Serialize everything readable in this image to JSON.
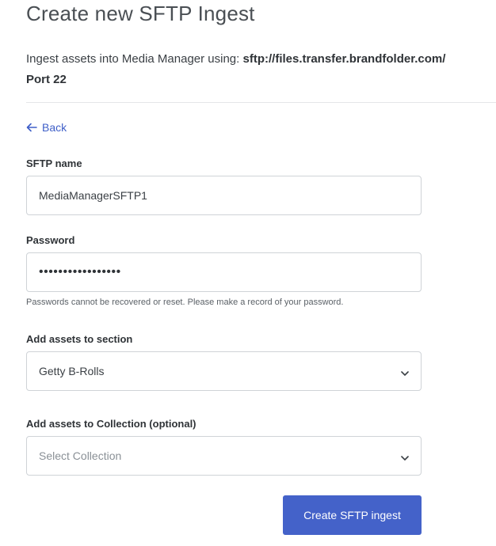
{
  "header": {
    "title": "Create new SFTP Ingest",
    "subtitle_prefix": "Ingest assets into Media Manager using: ",
    "sftp_url": "sftp://files.transfer.brandfolder.com/",
    "port": "Port 22"
  },
  "nav": {
    "back_label": "Back"
  },
  "form": {
    "sftp_name": {
      "label": "SFTP name",
      "value": "MediaManagerSFTP1"
    },
    "password": {
      "label": "Password",
      "value": "•••••••••••••••••",
      "hint": "Passwords cannot be recovered or reset. Please make a record of your password."
    },
    "section": {
      "label": "Add assets to section",
      "value": "Getty B-Rolls"
    },
    "collection": {
      "label": "Add assets to Collection (optional)",
      "placeholder": "Select Collection"
    },
    "submit_label": "Create SFTP ingest"
  },
  "colors": {
    "accent": "#4462c9",
    "link": "#3f5fc8",
    "border": "#cfd3d7"
  }
}
